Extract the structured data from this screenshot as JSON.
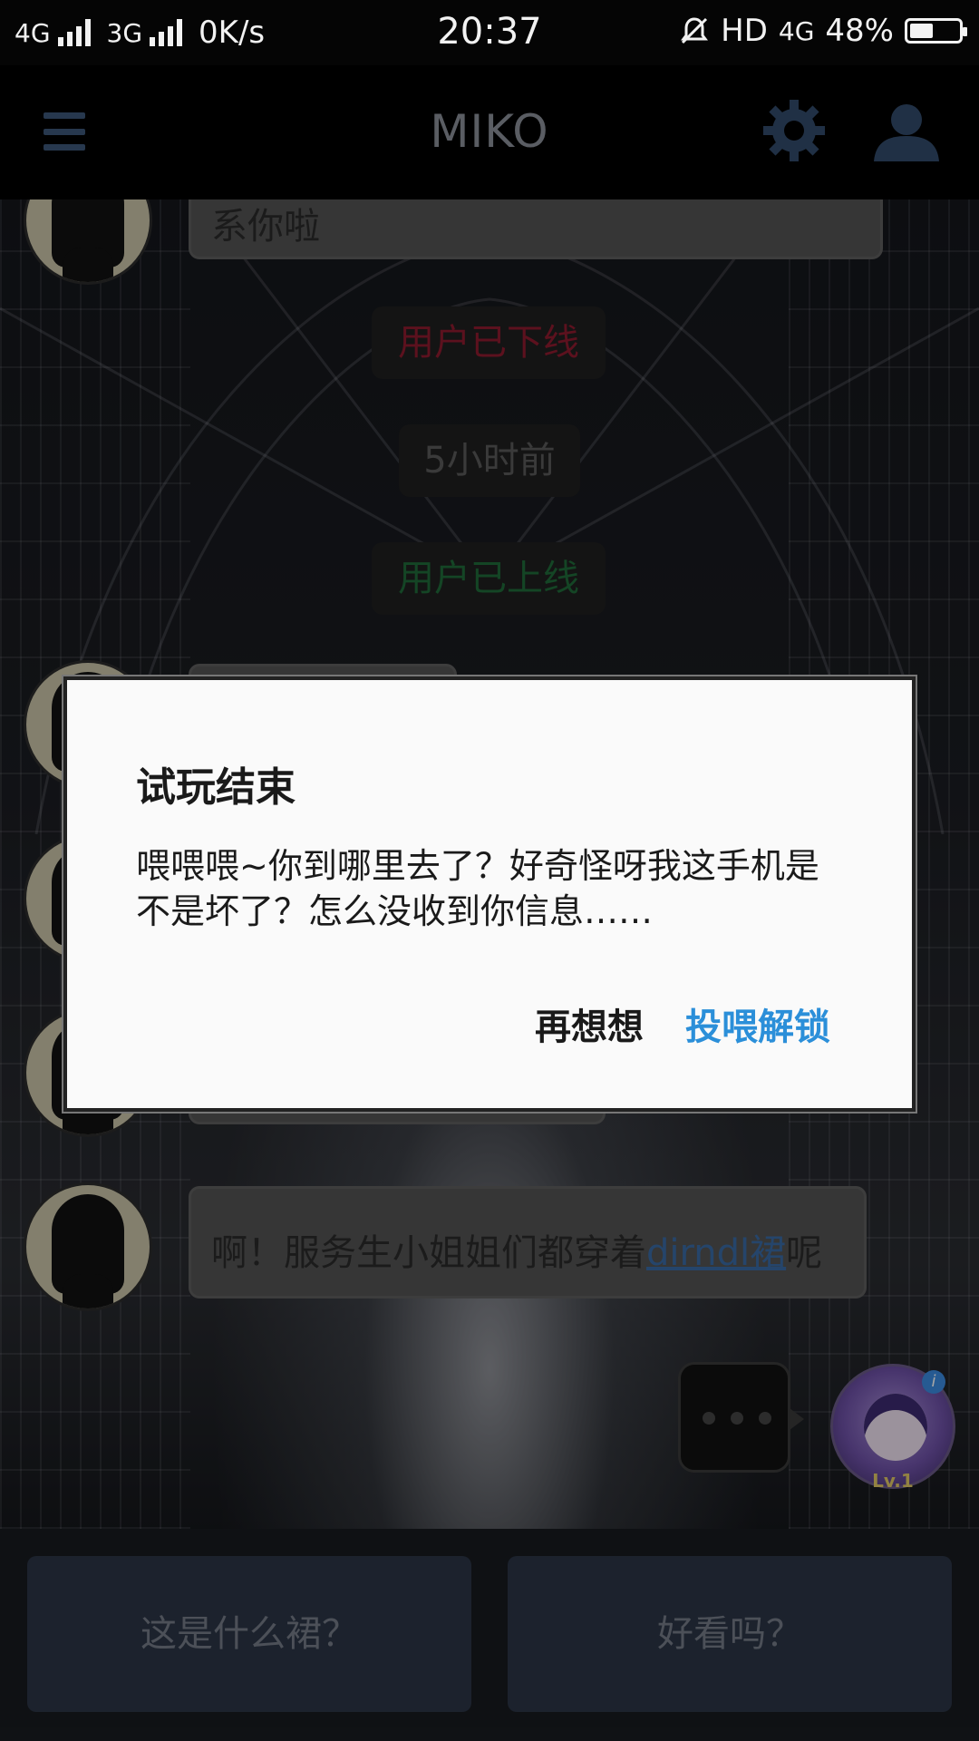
{
  "status_bar": {
    "network_1": "4G",
    "network_2": "3G",
    "speed": "0K/s",
    "time": "20:37",
    "hd": "HD",
    "network_3": "4G",
    "battery_percent": "48%",
    "battery_level": 0.48
  },
  "header": {
    "title": "MIKO",
    "menu_icon": "hamburger-menu-icon",
    "settings_icon": "gear-icon",
    "profile_icon": "user-icon"
  },
  "chat": {
    "top_message_partial": "系你啦",
    "status_offline": "用户已下线",
    "time_ago": "5小时前",
    "status_online": "用户已上线",
    "last_message_text": "啊！服务生小姐姐们都穿着",
    "last_message_link": "dirndl裙",
    "last_message_suffix": "呢",
    "mini_avatar_level": "Lv.1",
    "mini_avatar_badge": "i",
    "colors": {
      "offline": "#8e1b2e",
      "online": "#1f6b3a",
      "neutral": "#5a5a5a"
    }
  },
  "dialog": {
    "title": "试玩结束",
    "message": "喂喂喂~你到哪里去了？好奇怪呀我这手机是不是坏了？怎么没收到你信息……",
    "cancel_label": "再想想",
    "confirm_label": "投喂解锁",
    "confirm_color": "#2b8fd9"
  },
  "replies": [
    {
      "label": "这是什么裙？"
    },
    {
      "label": "好看吗？"
    }
  ]
}
